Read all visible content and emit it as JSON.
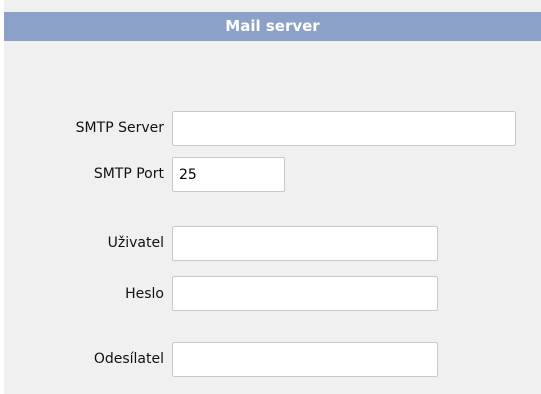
{
  "panel": {
    "title": "Mail server"
  },
  "form": {
    "smtp_server": {
      "label": "SMTP Server",
      "value": ""
    },
    "smtp_port": {
      "label": "SMTP Port",
      "value": "25"
    },
    "user": {
      "label": "Uživatel",
      "value": ""
    },
    "password": {
      "label": "Heslo",
      "value": ""
    },
    "sender": {
      "label": "Odesílatel",
      "value": ""
    }
  },
  "colors": {
    "header_background": "#8ca1c7",
    "panel_background": "#f0f0f0",
    "input_border": "#c9c9c9"
  }
}
